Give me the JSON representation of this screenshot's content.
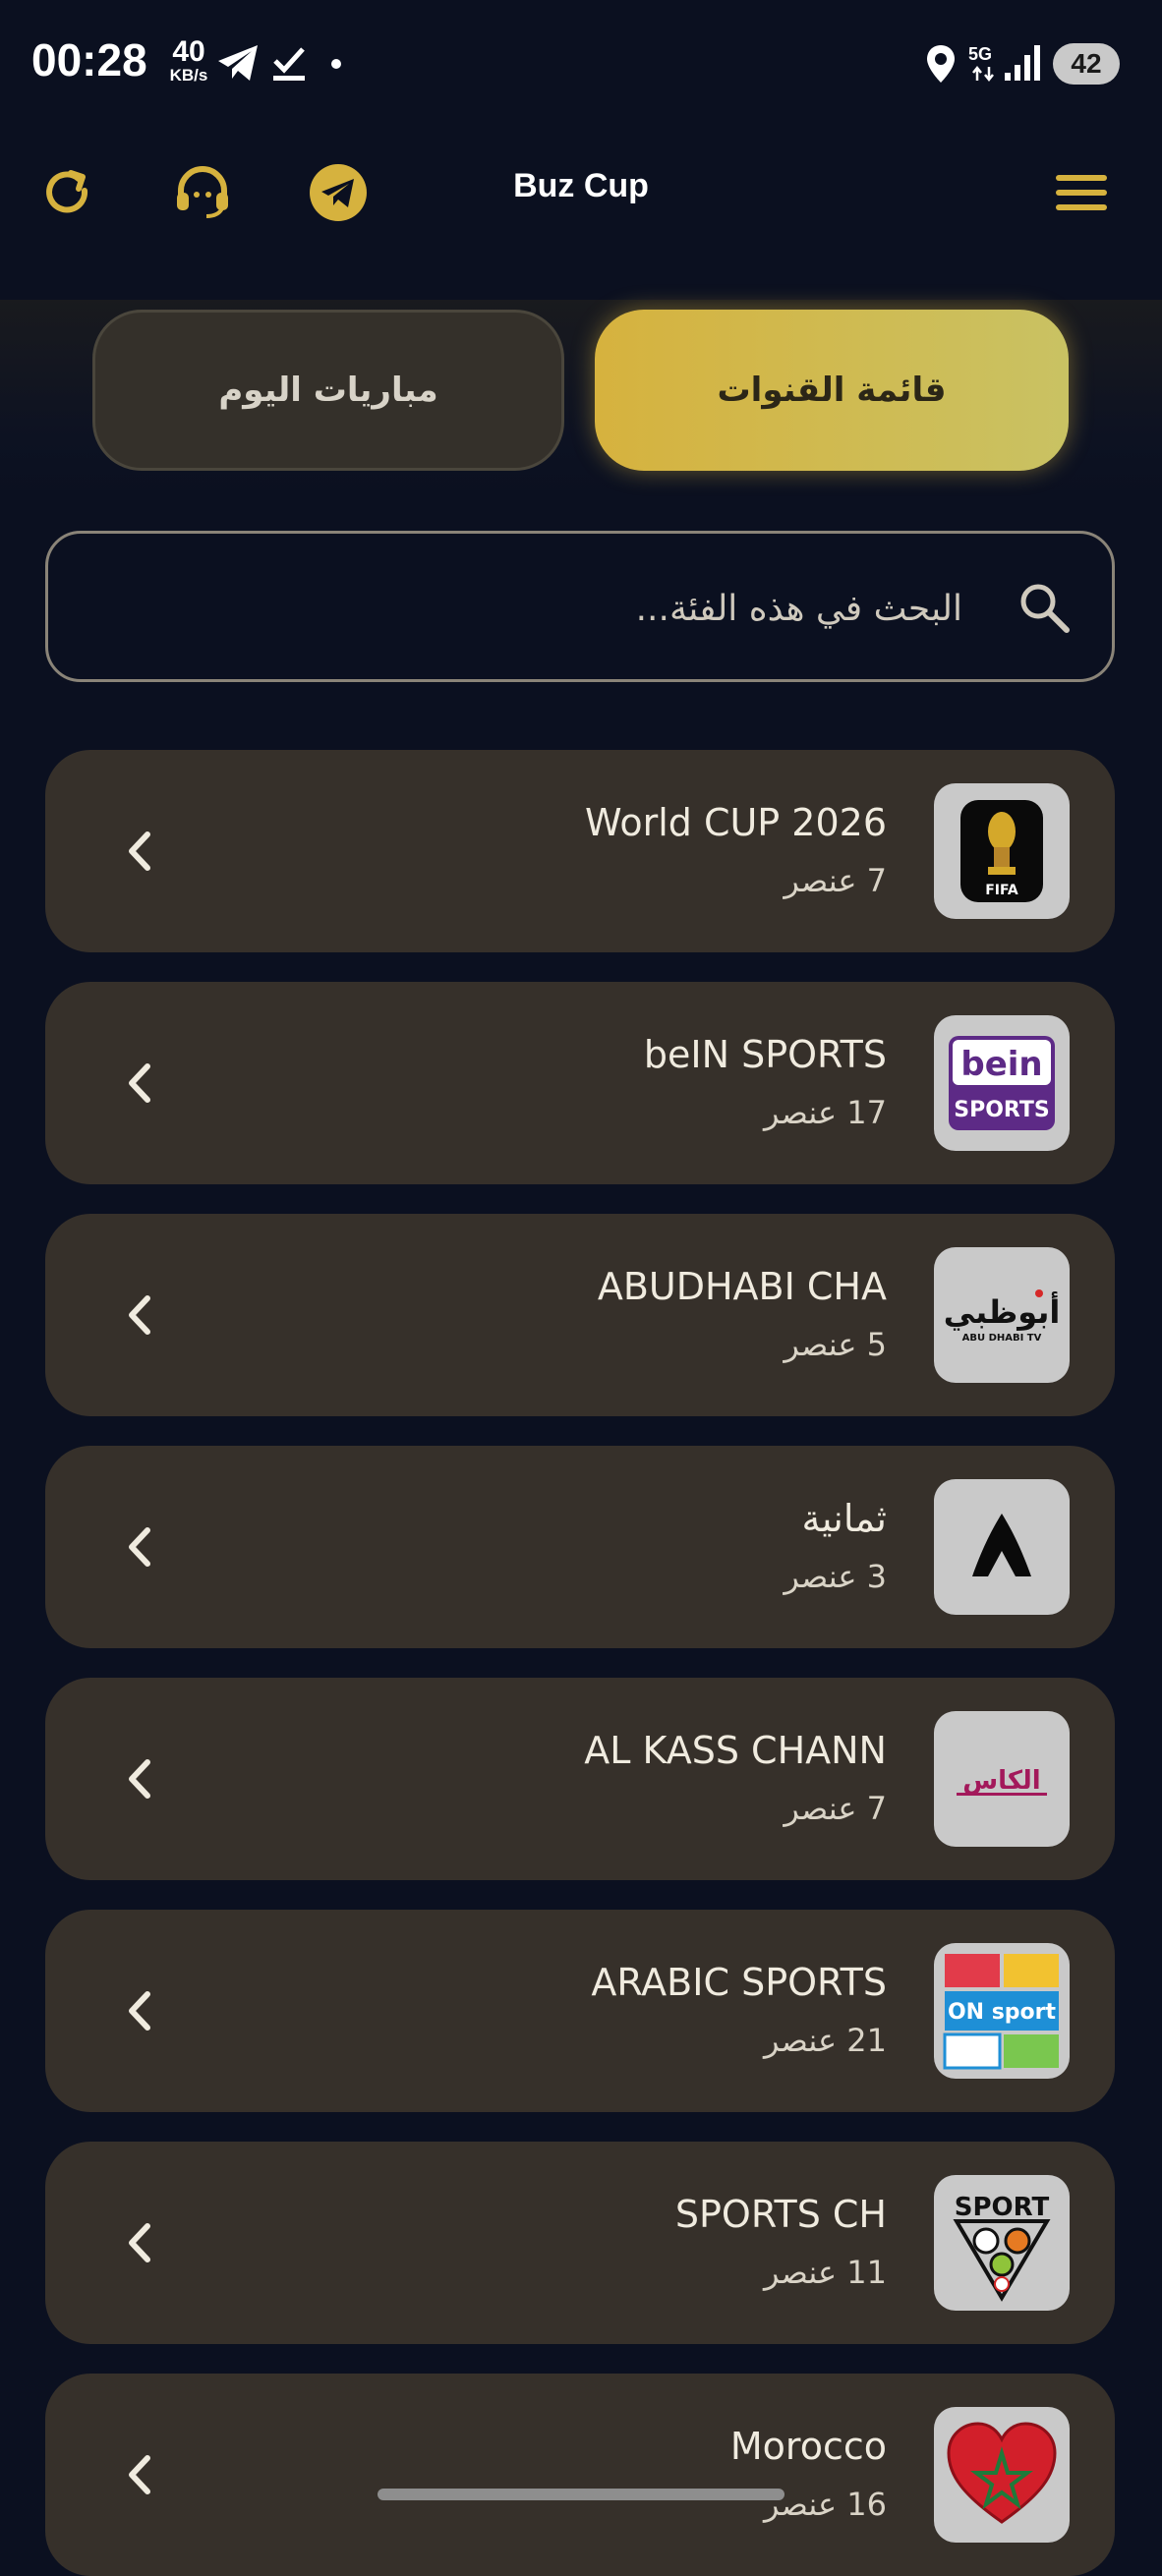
{
  "status_bar": {
    "time": "00:28",
    "net_speed_value": "40",
    "net_speed_unit": "KB/s",
    "network": "5G",
    "battery": "42"
  },
  "app_bar": {
    "title": "Buz Cup",
    "icons": [
      "refresh-icon",
      "support-headset-icon",
      "telegram-icon",
      "menu-icon"
    ],
    "accent_color": "#d6b23e"
  },
  "tabs": {
    "channels_label": "قائمة القنوات",
    "matches_label": "مباريات اليوم",
    "active": "channels"
  },
  "search": {
    "placeholder": "البحث في هذه الفئة..."
  },
  "categories": [
    {
      "title": "World CUP 2026",
      "count": "7 عنصر",
      "logo": "fifa-world-cup-2026-logo"
    },
    {
      "title": "beIN SPORTS",
      "count": "17 عنصر",
      "logo": "bein-sports-logo",
      "logo_text_1": "bein",
      "logo_text_2": "SPORTS"
    },
    {
      "title": "ABUDHABI CHA",
      "count": "5 عنصر",
      "logo": "abu-dhabi-tv-logo",
      "logo_text_1": "أبوظبي",
      "logo_text_2": "ABU DHABI TV"
    },
    {
      "title": "ثمانية",
      "count": "3 عنصر",
      "logo": "thmanyah-logo"
    },
    {
      "title": "AL KASS CHANN",
      "count": "7 عنصر",
      "logo": "alkass-logo",
      "logo_text_1": "الكاس"
    },
    {
      "title": "ARABIC SPORTS",
      "count": "21 عنصر",
      "logo": "arabic-sports-collage-logo",
      "logo_text_1": "ON sport"
    },
    {
      "title": "SPORTS CH",
      "count": "11 عنصر",
      "logo": "sport-balls-logo",
      "logo_text_1": "SPORT"
    },
    {
      "title": "Morocco",
      "count": "16 عنصر",
      "logo": "morocco-heart-flag-logo"
    }
  ]
}
